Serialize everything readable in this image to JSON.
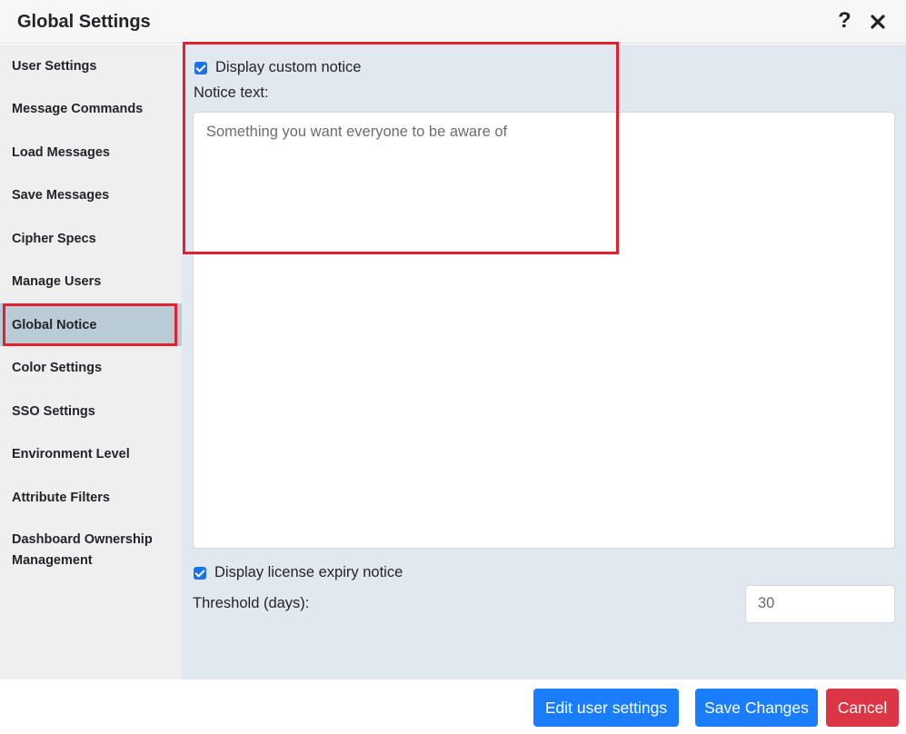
{
  "window": {
    "title": "Global Settings",
    "help_icon": "question-mark-icon",
    "close_icon": "close-icon"
  },
  "sidebar": {
    "items": [
      {
        "label": "User Settings"
      },
      {
        "label": "Message Commands"
      },
      {
        "label": "Load Messages"
      },
      {
        "label": "Save Messages"
      },
      {
        "label": "Cipher Specs"
      },
      {
        "label": "Manage Users"
      },
      {
        "label": "Global Notice",
        "active": true
      },
      {
        "label": "Color Settings"
      },
      {
        "label": "SSO Settings"
      },
      {
        "label": "Environment Level"
      },
      {
        "label": "Attribute Filters"
      },
      {
        "label": "Dashboard Ownership Management"
      }
    ]
  },
  "main": {
    "custom_notice": {
      "checkbox_label": "Display custom notice",
      "checked": true,
      "text_label": "Notice text:",
      "text_value": "Something you want everyone to be aware of"
    },
    "license_notice": {
      "checkbox_label": "Display license expiry notice",
      "checked": true,
      "threshold_label": "Threshold (days):",
      "threshold_value": "30"
    }
  },
  "footer": {
    "edit_user_settings": "Edit user settings",
    "save_changes": "Save Changes",
    "cancel": "Cancel"
  },
  "colors": {
    "accent_blue": "#1a7dfe",
    "danger_red": "#dc3545",
    "highlight_outline": "#e3202f",
    "active_item_bg": "#b9ccd5"
  }
}
